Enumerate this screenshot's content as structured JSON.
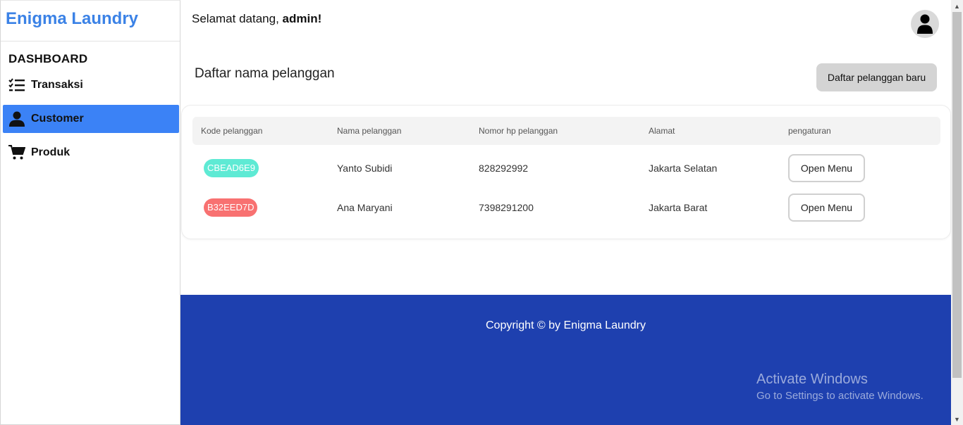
{
  "sidebar": {
    "brand": "Enigma Laundry",
    "section_title": "DASHBOARD",
    "items": [
      {
        "label": "Transaksi",
        "icon": "checklist-icon",
        "active": false
      },
      {
        "label": "Customer",
        "icon": "user-icon",
        "active": true
      },
      {
        "label": "Produk",
        "icon": "cart-icon",
        "active": false
      }
    ]
  },
  "header": {
    "welcome_prefix": "Selamat datang, ",
    "username": "admin!",
    "avatar_icon": "user-avatar-icon"
  },
  "main": {
    "title": "Daftar nama pelanggan",
    "new_button": "Daftar pelanggan baru",
    "table": {
      "columns": [
        "Kode pelanggan",
        "Nama pelanggan",
        "Nomor hp pelanggan",
        "Alamat",
        "pengaturan"
      ],
      "rows": [
        {
          "code": "CBEAD6E9",
          "code_color": "#5eead4",
          "name": "Yanto Subidi",
          "phone": "828292992",
          "address": "Jakarta Selatan",
          "action": "Open Menu"
        },
        {
          "code": "B32EED7D",
          "code_color": "#f87171",
          "name": "Ana Maryani",
          "phone": "7398291200",
          "address": "Jakarta Barat",
          "action": "Open Menu"
        }
      ]
    }
  },
  "footer": {
    "copyright": "Copyright © by Enigma Laundry",
    "color": "#1e40af"
  },
  "watermark": {
    "line1": "Activate Windows",
    "line2": "Go to Settings to activate Windows."
  },
  "colors": {
    "brand": "#3b82e6",
    "active_nav": "#3b82f6"
  }
}
